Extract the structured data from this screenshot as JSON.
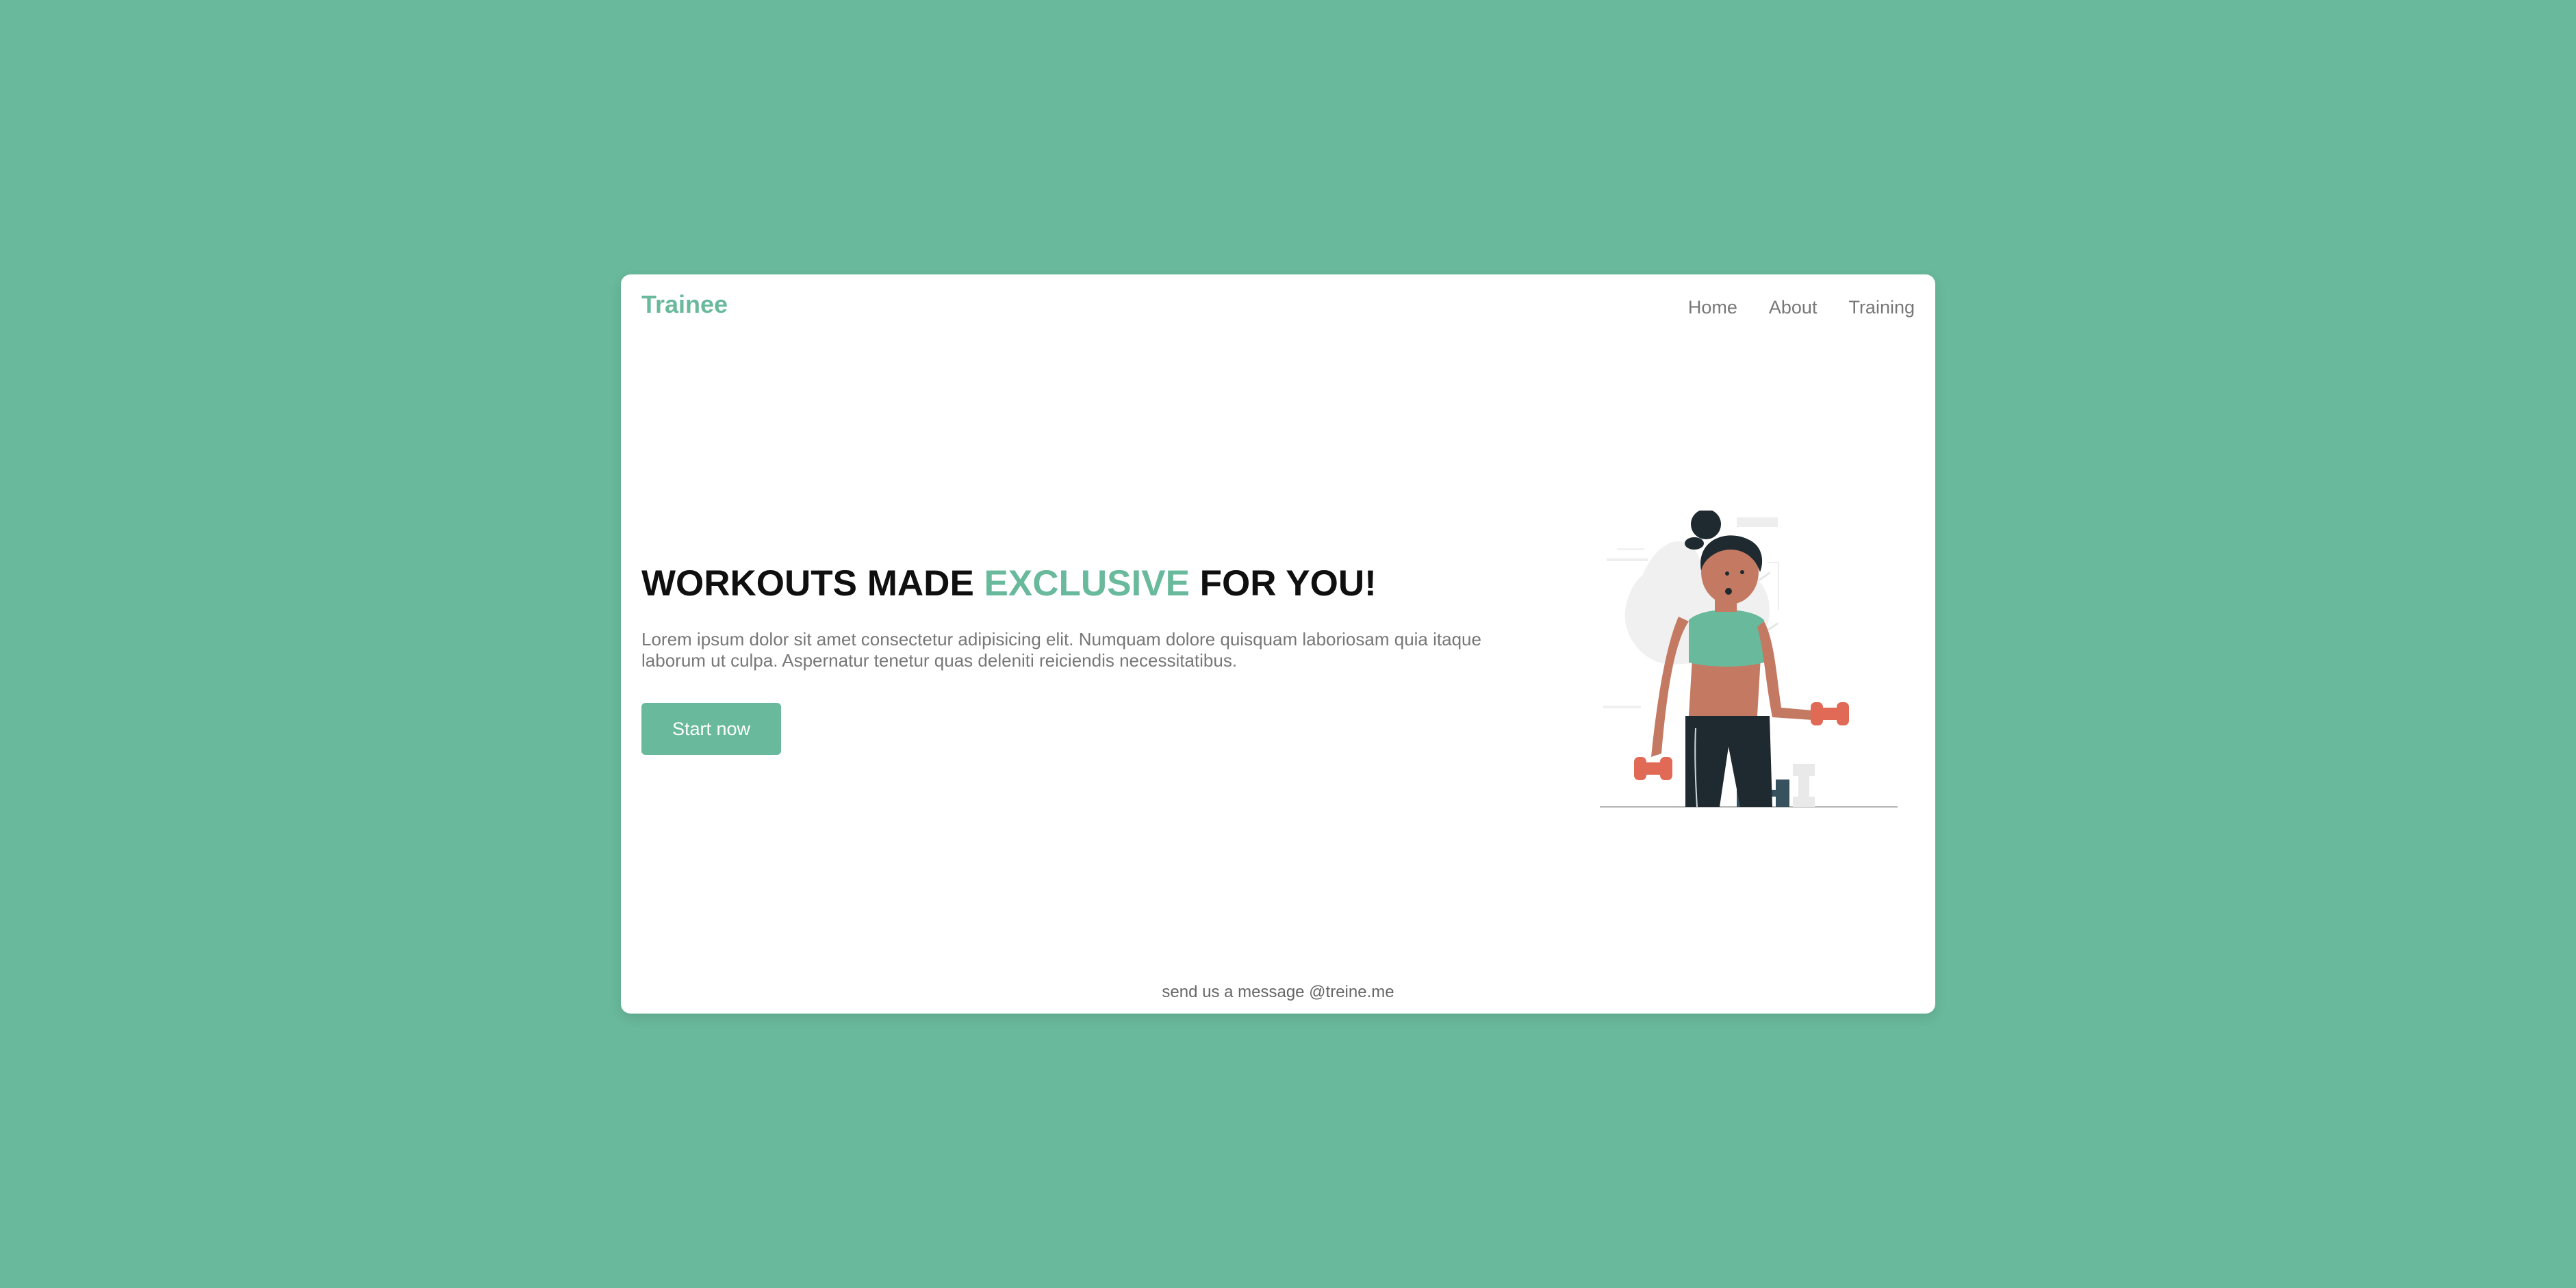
{
  "brand": {
    "logo": "Trainee"
  },
  "nav": {
    "items": [
      "Home",
      "About",
      "Training"
    ]
  },
  "hero": {
    "headline_pre": "WORKOUTS MADE ",
    "headline_accent": "EXCLUSIVE",
    "headline_post": " FOR YOU!",
    "description": "Lorem ipsum dolor sit amet consectetur adipisicing elit. Numquam dolore quisquam laboriosam quia itaque laborum ut culpa. Aspernatur tenetur quas deleniti reiciendis necessitatibus.",
    "cta_label": "Start now",
    "illustration_icon": "woman-lifting-dumbbells-illustration"
  },
  "footer": {
    "text": "send us a message @treine.me"
  },
  "colors": {
    "accent": "#69b99c",
    "background": "#69b99c",
    "card": "#ffffff",
    "body_text": "#777777",
    "headline": "#0f0f0f"
  }
}
